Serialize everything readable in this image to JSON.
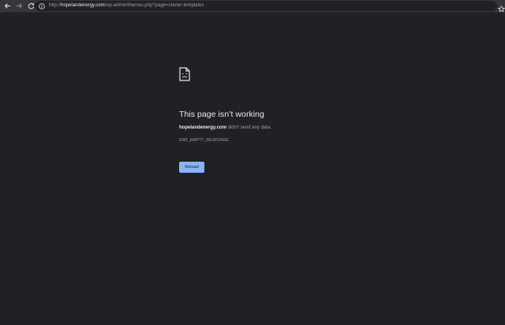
{
  "toolbar": {
    "back_icon": "arrow-left-icon",
    "forward_icon": "arrow-right-icon",
    "reload_icon": "reload-icon",
    "url_host": "hopelandenergy.com",
    "url_scheme": "http://",
    "url_path": "/wp-admin/themes.php?page=starter-templates",
    "bookmark_icon": "star-icon"
  },
  "error": {
    "icon": "sad-page-icon",
    "title": "This page isn’t working",
    "host": "hopelandenergy.com",
    "message": " didn’t send any data.",
    "code": "ERR_EMPTY_RESPONSE",
    "reload_label": "Reload"
  },
  "colors": {
    "background": "#202124",
    "toolbar": "#35363a",
    "accent": "#8ab4f8"
  }
}
